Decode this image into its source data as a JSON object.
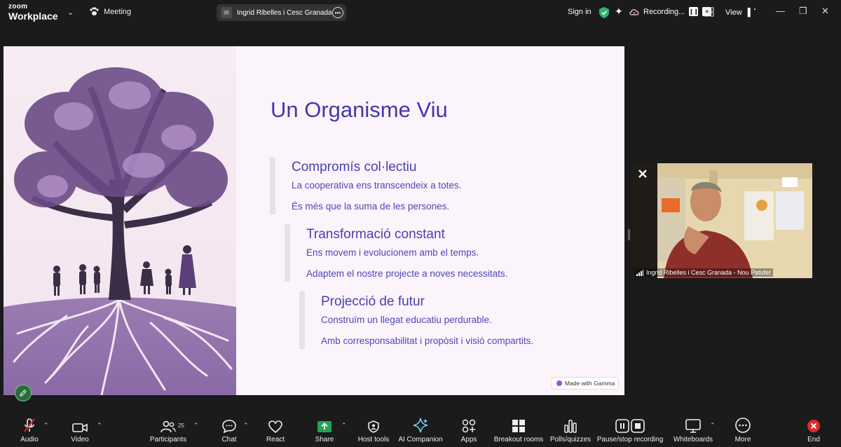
{
  "topbar": {
    "logo_line1": "zoom",
    "logo_line2": "Workplace",
    "meeting_label": "Meeting",
    "participant_initials": "IR",
    "participant_pill": "Ingrid Ribelles i Cesc Granada - Nou Patufet",
    "sign_in": "Sign in",
    "recording": "Recording...",
    "view": "View",
    "icons": [
      "zoom-logo",
      "chevron-down-icon",
      "paw-icon",
      "ellipsis-icon",
      "shield-check-icon",
      "sparkle-icon",
      "cloud-recording-icon",
      "pause-icon",
      "stop-icon",
      "grid-icon",
      "view-icon",
      "minimize-icon",
      "restore-icon",
      "close-icon"
    ]
  },
  "slide": {
    "title": "Un Organisme Viu",
    "sections": [
      {
        "heading": "Compromís col·lectiu",
        "line1": "La cooperativa ens transcendeix a totes.",
        "line2": "És més que la suma de les persones."
      },
      {
        "heading": "Transformació constant",
        "line1": "Ens movem i evolucionem amb el temps.",
        "line2": "Adaptem el nostre projecte a noves necessitats."
      },
      {
        "heading": "Projecció de futur",
        "line1": "Construïm un llegat educatiu perdurable.",
        "line2": "Amb corresponsabilitat i propòsit i visió compartits."
      }
    ],
    "badge": "Made with Gamma",
    "illustration": "tree-with-roots-and-children"
  },
  "video": {
    "name": "Ingrid Ribelles i Cesc Granada - Nou Patufet",
    "icons": [
      "signal-bars-icon",
      "muted-cross-icon"
    ]
  },
  "toolbar": {
    "audio": "Audio",
    "video": "Video",
    "participants": "Participants",
    "participants_count": "25",
    "chat": "Chat",
    "react": "React",
    "share": "Share",
    "host_tools": "Host tools",
    "ai_companion": "AI Companion",
    "apps": "Apps",
    "breakout_rooms": "Breakout rooms",
    "polls": "Polls/quizzes",
    "pause_stop": "Pause/stop recording",
    "whiteboards": "Whiteboards",
    "more": "More",
    "end": "End"
  },
  "colors": {
    "slide_bg": "#fcf4fb",
    "slide_text": "#4338a8",
    "share_green": "#21a453",
    "end_red": "#e02828",
    "shield_green": "#2fb36a"
  }
}
